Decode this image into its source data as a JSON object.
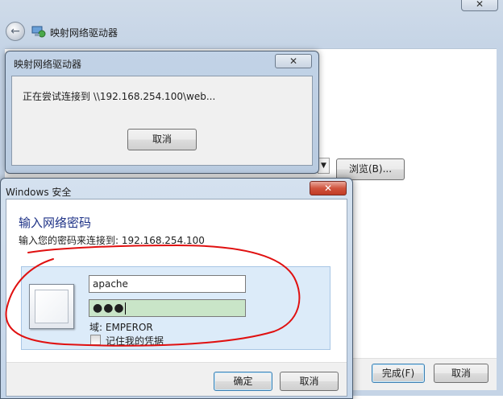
{
  "wizard": {
    "title": "映射网络驱动器",
    "browse_label": "浏览(B)...",
    "finish_label": "完成(F)",
    "cancel_label": "取消",
    "close_glyph": "✕"
  },
  "connect_dialog": {
    "title": "映射网络驱动器",
    "message": "正在尝试连接到 \\\\192.168.254.100\\web...",
    "cancel_label": "取消",
    "close_glyph": "✕"
  },
  "security_dialog": {
    "title": "Windows 安全",
    "heading": "输入网络密码",
    "subtext": "输入您的密码来连接到: 192.168.254.100",
    "username_value": "apache",
    "password_mask": "●●●",
    "domain_label": "域: EMPEROR",
    "remember_label": "记住我的凭据",
    "remember_checked": false,
    "ok_label": "确定",
    "cancel_label": "取消",
    "close_glyph": "✕"
  },
  "icons": {
    "back": "back-arrow-icon",
    "network_drive": "network-drive-icon",
    "user": "user-tile-icon"
  },
  "colors": {
    "annotation": "#e01010",
    "heading_blue": "#1e3287",
    "password_bg": "#c9e5c8",
    "close_red": "#c13b25"
  }
}
